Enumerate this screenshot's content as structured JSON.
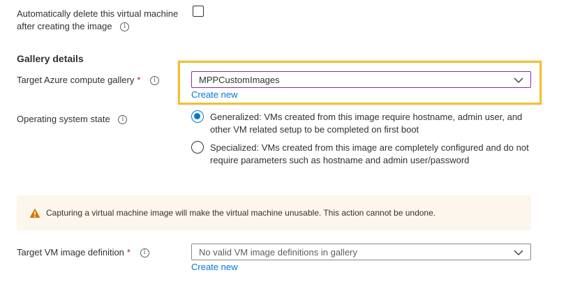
{
  "auto_delete": {
    "label_line1": "Automatically delete this virtual machine",
    "label_line2": "after creating the image",
    "checked": false
  },
  "gallery_details": {
    "title": "Gallery details",
    "target_gallery": {
      "label": "Target Azure compute gallery",
      "required_mark": "*",
      "value": "MPPCustomImages",
      "create_new": "Create new"
    },
    "os_state": {
      "label": "Operating system state",
      "options": [
        {
          "label": "Generalized: VMs created from this image require hostname, admin user, and other VM related setup to be completed on first boot",
          "selected": true
        },
        {
          "label": "Specialized: VMs created from this image are completely configured and do not require parameters such as hostname and admin user/password",
          "selected": false
        }
      ]
    }
  },
  "warning": {
    "text": "Capturing a virtual machine image will make the virtual machine unusable. This action cannot be undone.",
    "color": "#d47500"
  },
  "image_definition": {
    "label": "Target VM image definition",
    "required_mark": "*",
    "value": "No valid VM image definitions in gallery",
    "create_new": "Create new"
  },
  "colors": {
    "accent": "#0078d4",
    "highlight": "#f2c12e",
    "focus_border": "#8a2da5",
    "required": "#a4262c",
    "warning_bg": "#fdf6ec"
  }
}
